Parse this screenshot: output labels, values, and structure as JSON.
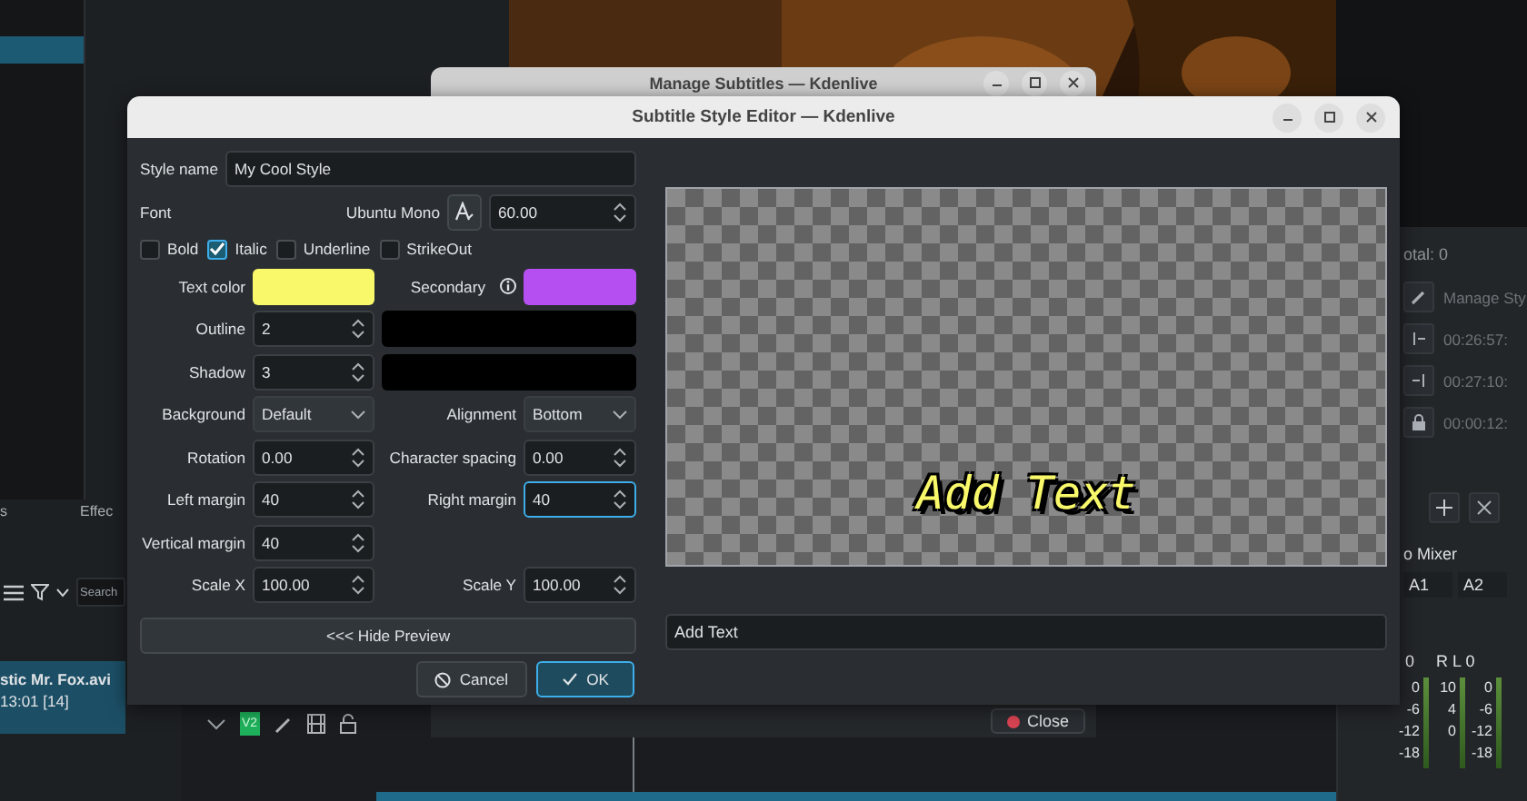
{
  "background_app": {
    "left_tabs": [
      "s",
      "Effec"
    ],
    "bin_search": {
      "placeholder": "Search"
    },
    "clip": {
      "name": "stic Mr. Fox.avi",
      "info": "13:01 [14]",
      "selected": true
    },
    "track": {
      "tag": "V2"
    },
    "subtitle_panel": {
      "total": "otal: 0",
      "rows": [
        {
          "kind": "pencil",
          "text": "Manage Sty"
        },
        {
          "kind": "in",
          "text": "00:26:57:"
        },
        {
          "kind": "out",
          "text": "00:27:10:"
        },
        {
          "kind": "lock",
          "text": "00:00:12:"
        }
      ]
    },
    "mixer": {
      "title": "o Mixer",
      "channels": [
        "A1",
        "A2"
      ],
      "balance": [
        "0",
        "R L 0"
      ],
      "scales": [
        [
          "0",
          "-6",
          "-12",
          "-18"
        ],
        [
          "10",
          "4",
          "0"
        ],
        [
          "0",
          "-6",
          "-12",
          "-18"
        ]
      ]
    }
  },
  "manage_subtitles": {
    "title": "Manage Subtitles — Kdenlive",
    "close_button": "Close"
  },
  "dialog": {
    "title": "Subtitle Style Editor — Kdenlive",
    "style_name": {
      "label": "Style name",
      "value": "My Cool Style"
    },
    "font": {
      "label": "Font",
      "family": "Ubuntu Mono",
      "size": "60.00"
    },
    "styles": [
      {
        "label": "Bold",
        "checked": false
      },
      {
        "label": "Italic",
        "checked": true
      },
      {
        "label": "Underline",
        "checked": false
      },
      {
        "label": "StrikeOut",
        "checked": false
      }
    ],
    "text_color": {
      "label": "Text color",
      "color": "#f8f86a"
    },
    "secondary_color": {
      "label": "Secondary",
      "color": "#b54ff2"
    },
    "outline": {
      "label": "Outline",
      "value": "2",
      "color": "#000000"
    },
    "shadow": {
      "label": "Shadow",
      "value": "3",
      "color": "#000000"
    },
    "rows": [
      [
        {
          "kind": "combo",
          "label": "Background",
          "value": "Default",
          "focused": false
        },
        {
          "kind": "combo",
          "label": "Alignment",
          "value": "Bottom",
          "focused": false
        }
      ],
      [
        {
          "kind": "spin",
          "label": "Rotation",
          "value": "0.00",
          "focused": false
        },
        {
          "kind": "spin",
          "label": "Character spacing",
          "value": "0.00",
          "focused": false
        }
      ],
      [
        {
          "kind": "spin",
          "label": "Left margin",
          "value": "40",
          "focused": false
        },
        {
          "kind": "spin",
          "label": "Right margin",
          "value": "40",
          "focused": true
        }
      ],
      [
        {
          "kind": "spin",
          "label": "Vertical margin",
          "value": "40",
          "focused": false
        }
      ],
      [
        {
          "kind": "spin",
          "label": "Scale X",
          "value": "100.00",
          "focused": false
        },
        {
          "kind": "spin",
          "label": "Scale Y",
          "value": "100.00",
          "focused": false
        }
      ]
    ],
    "hide_preview": "<<< Hide Preview",
    "cancel": "Cancel",
    "ok": "OK",
    "preview": {
      "rendered_text": "Add Text",
      "input_value": "Add Text"
    }
  }
}
